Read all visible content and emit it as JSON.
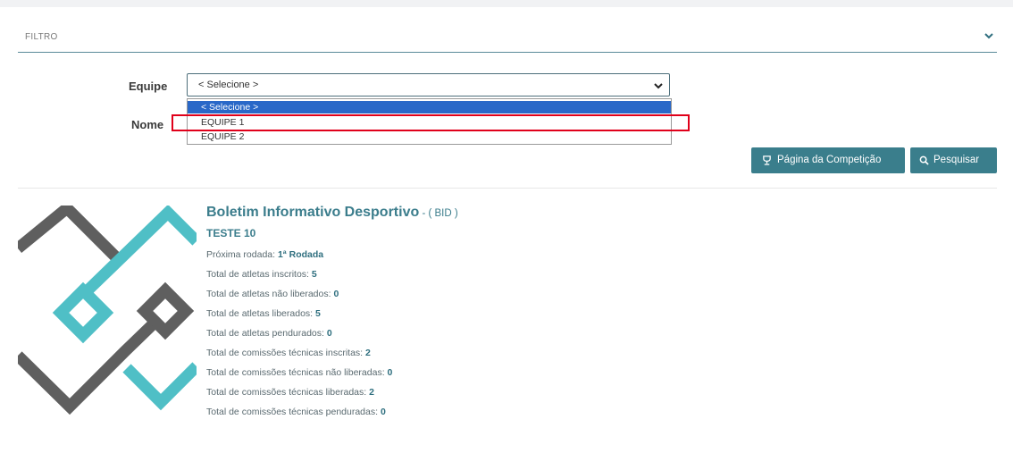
{
  "filter": {
    "title": "FILTRO",
    "toggle_icon": "chevron-down-icon"
  },
  "form": {
    "team_label": "Equipe",
    "team_value": "< Selecione >",
    "team_options": [
      "< Selecione >",
      "EQUIPE 1",
      "EQUIPE 2"
    ],
    "name_label": "Nome"
  },
  "buttons": {
    "competition_page": "Página da Competição",
    "search": "Pesquisar"
  },
  "bulletin": {
    "title": "Boletim Informativo Desportivo",
    "title_suffix": " - ( BID )",
    "competition": "TESTE 10",
    "stats": [
      {
        "label": "Próxima rodada: ",
        "value": "1ª Rodada"
      },
      {
        "label": "Total de atletas inscritos: ",
        "value": "5"
      },
      {
        "label": "Total de atletas não liberados: ",
        "value": "0"
      },
      {
        "label": "Total de atletas liberados: ",
        "value": "5"
      },
      {
        "label": "Total de atletas pendurados: ",
        "value": "0"
      },
      {
        "label": "Total de comissões técnicas inscritas: ",
        "value": "2"
      },
      {
        "label": "Total de comissões técnicas não liberadas: ",
        "value": "0"
      },
      {
        "label": "Total de comissões técnicas liberadas: ",
        "value": "2"
      },
      {
        "label": "Total de comissões técnicas penduradas: ",
        "value": "0"
      }
    ]
  },
  "colors": {
    "accent": "#3a7e8c",
    "logo_teal": "#4fbfc6",
    "logo_gray": "#5f5f5f",
    "selected_option": "#2968c8",
    "highlight": "#e0001a"
  }
}
